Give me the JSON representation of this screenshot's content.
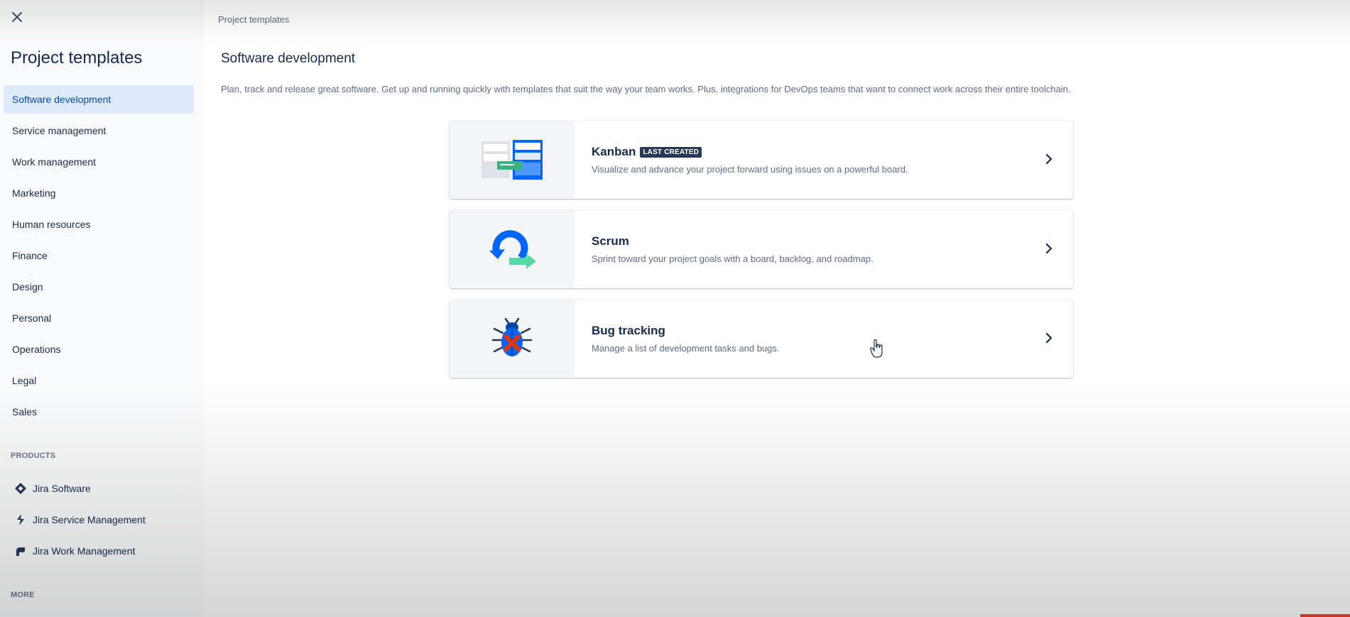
{
  "sidebar": {
    "close_icon": "close-icon",
    "title": "Project templates",
    "categories": [
      {
        "label": "Software development",
        "active": true
      },
      {
        "label": "Service management",
        "active": false
      },
      {
        "label": "Work management",
        "active": false
      },
      {
        "label": "Marketing",
        "active": false
      },
      {
        "label": "Human resources",
        "active": false
      },
      {
        "label": "Finance",
        "active": false
      },
      {
        "label": "Design",
        "active": false
      },
      {
        "label": "Personal",
        "active": false
      },
      {
        "label": "Operations",
        "active": false
      },
      {
        "label": "Legal",
        "active": false
      },
      {
        "label": "Sales",
        "active": false
      }
    ],
    "products_label": "PRODUCTS",
    "products": [
      {
        "label": "Jira Software",
        "icon": "jira-software-icon"
      },
      {
        "label": "Jira Service Management",
        "icon": "jira-service-management-icon"
      },
      {
        "label": "Jira Work Management",
        "icon": "jira-work-management-icon"
      }
    ],
    "more_label": "MORE"
  },
  "main": {
    "breadcrumb": "Project templates",
    "title": "Software development",
    "description": "Plan, track and release great software. Get up and running quickly with templates that suit the way your team works. Plus, integrations for DevOps teams that want to connect work across their entire toolchain.",
    "templates": [
      {
        "title": "Kanban",
        "badge": "LAST CREATED",
        "description": "Visualize and advance your project forward using issues on a powerful board.",
        "illustration": "kanban-illustration"
      },
      {
        "title": "Scrum",
        "badge": "",
        "description": "Sprint toward your project goals with a board, backlog, and roadmap.",
        "illustration": "scrum-illustration"
      },
      {
        "title": "Bug tracking",
        "badge": "",
        "description": "Manage a list of development tasks and bugs.",
        "illustration": "bug-tracking-illustration"
      }
    ]
  },
  "colors": {
    "accent": "#0052cc",
    "active_nav_bg": "#deebff",
    "text_primary": "#172b4d",
    "text_subtle": "#5e6c84",
    "badge_bg": "#253858"
  }
}
